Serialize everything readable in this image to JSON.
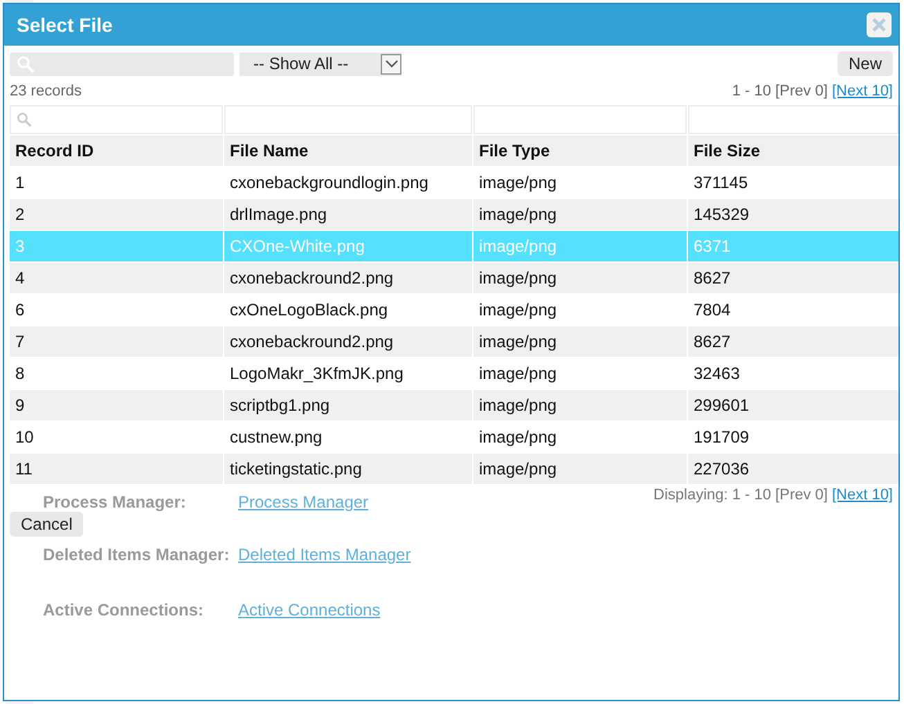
{
  "background_page": {
    "rows": [
      {
        "label": "Process Manager:",
        "link": "Process Manager"
      },
      {
        "label": "Deleted Items Manager:",
        "link": "Deleted Items Manager"
      },
      {
        "label": "Active Connections:",
        "link": "Active Connections"
      }
    ]
  },
  "dialog": {
    "title": "Select File",
    "filter": {
      "value": "-- Show All --"
    },
    "new_button": "New",
    "record_count": "23 records",
    "pager_top": {
      "text": "1 - 10 [Prev 0]",
      "next_link": "[Next 10]"
    },
    "table": {
      "columns": [
        "Record ID",
        "File Name",
        "File Type",
        "File Size"
      ],
      "rows": [
        {
          "cells": [
            "1",
            "cxonebackgroundlogin.png",
            "image/png",
            "371145"
          ],
          "selected": false
        },
        {
          "cells": [
            "2",
            "drlImage.png",
            "image/png",
            "145329"
          ],
          "selected": false
        },
        {
          "cells": [
            "3",
            "CXOne-White.png",
            "image/png",
            "6371"
          ],
          "selected": true
        },
        {
          "cells": [
            "4",
            "cxonebackround2.png",
            "image/png",
            "8627"
          ],
          "selected": false
        },
        {
          "cells": [
            "6",
            "cxOneLogoBlack.png",
            "image/png",
            "7804"
          ],
          "selected": false
        },
        {
          "cells": [
            "7",
            "cxonebackround2.png",
            "image/png",
            "8627"
          ],
          "selected": false
        },
        {
          "cells": [
            "8",
            "LogoMakr_3KfmJK.png",
            "image/png",
            "32463"
          ],
          "selected": false
        },
        {
          "cells": [
            "9",
            "scriptbg1.png",
            "image/png",
            "299601"
          ],
          "selected": false
        },
        {
          "cells": [
            "10",
            "custnew.png",
            "image/png",
            "191709"
          ],
          "selected": false
        },
        {
          "cells": [
            "11",
            "ticketingstatic.png",
            "image/png",
            "227036"
          ],
          "selected": false
        }
      ]
    },
    "pager_bottom": {
      "text": "Displaying: 1 - 10 [Prev 0]",
      "next_link": "[Next 10]"
    },
    "cancel_button": "Cancel"
  }
}
